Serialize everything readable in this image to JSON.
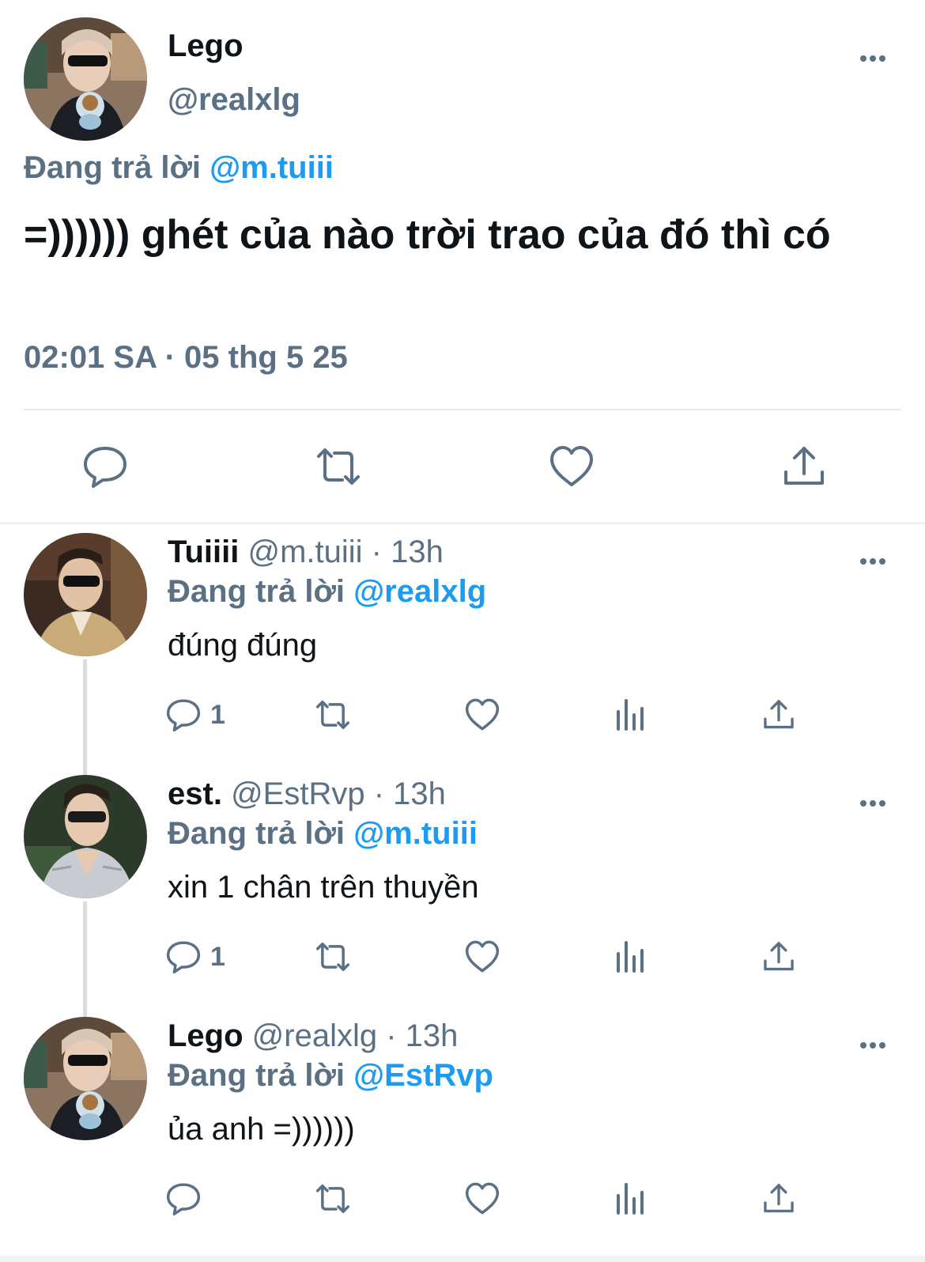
{
  "main_tweet": {
    "name": "Lego",
    "handle": "@realxlg",
    "replying_prefix": "Đang trả lời",
    "replying_to": "@m.tuiii",
    "text": "=)))))) ghét của nào trời trao của đó thì có",
    "timestamp": "02:01 SA · 05 thg 5 25",
    "actions": [
      "reply-icon",
      "retweet-icon",
      "like-icon",
      "share-icon"
    ]
  },
  "replies": [
    {
      "name": "Tuiiii",
      "meta": "@m.tuiii · 13h",
      "replying_prefix": "Đang trả lời",
      "replying_to": "@realxlg",
      "text": "đúng đúng",
      "reply_count": "1",
      "avatar": "avatar-tuiiii"
    },
    {
      "name": "est.",
      "meta": "@EstRvp · 13h",
      "replying_prefix": "Đang trả lời",
      "replying_to": "@m.tuiii",
      "text": "xin 1 chân trên thuyền",
      "reply_count": "1",
      "avatar": "avatar-est"
    },
    {
      "name": "Lego",
      "meta": "@realxlg · 13h",
      "replying_prefix": "Đang trả lời",
      "replying_to": "@EstRvp",
      "text": "ủa anh =))))))",
      "reply_count": "",
      "avatar": "avatar-lego"
    }
  ],
  "colors": {
    "text_primary": "#0f1419",
    "text_secondary": "#5b7083",
    "accent": "#1d9bf0",
    "divider": "#e5e9ec"
  }
}
